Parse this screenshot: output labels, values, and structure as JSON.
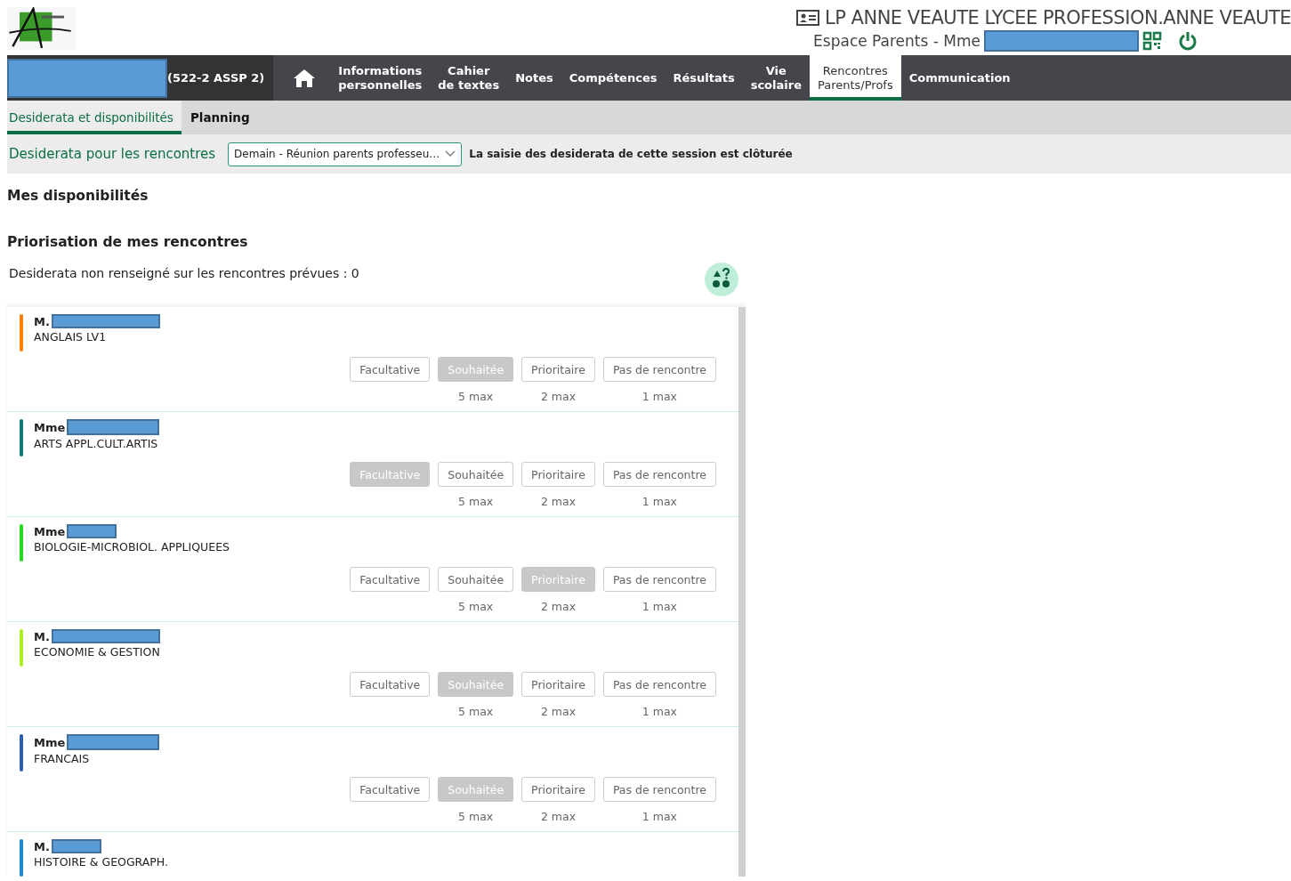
{
  "header": {
    "school": "LP ANNE VEAUTE LYCEE PROFESSION.ANNE VEAUTE",
    "space": "Espace Parents - Mme"
  },
  "nav": {
    "student_class": "(522-2 ASSP 2)",
    "items": [
      {
        "kind": "home",
        "selected": false
      },
      {
        "kind": "text",
        "label": "Informations\npersonnelles",
        "selected": false
      },
      {
        "kind": "text",
        "label": "Cahier\nde textes",
        "selected": false
      },
      {
        "kind": "text",
        "label": "Notes",
        "selected": false
      },
      {
        "kind": "text",
        "label": "Compétences",
        "selected": false
      },
      {
        "kind": "text",
        "label": "Résultats",
        "selected": false
      },
      {
        "kind": "text",
        "label": "Vie\nscolaire",
        "selected": false
      },
      {
        "kind": "text",
        "label": "Rencontres\nParents/Profs",
        "selected": true
      },
      {
        "kind": "text",
        "label": "Communication",
        "selected": false
      }
    ]
  },
  "tabs": [
    {
      "label": "Desiderata et disponibilités",
      "selected": true
    },
    {
      "label": "Planning",
      "selected": false
    }
  ],
  "filter": {
    "label": "Desiderata pour les rencontres",
    "session": "Demain - Réunion parents professeu…",
    "notice": "La saisie des desiderata de cette session est clôturée"
  },
  "sections": [
    {
      "title": "Mes disponibilités"
    },
    {
      "title": "Priorisation de mes rencontres"
    }
  ],
  "summary": "Desiderata non renseigné sur les rencontres prévues : 0",
  "meetings": [
    {
      "civility": "M.",
      "subject": "ANGLAIS LV1",
      "color": "#ff7f00",
      "options": [
        {
          "label": "Facultative",
          "selected": false
        },
        {
          "label": "Souhaitée",
          "limit": "5 max",
          "selected": true
        },
        {
          "label": "Prioritaire",
          "limit": "2 max",
          "selected": false
        },
        {
          "label": "Pas de rencontre",
          "limit": "1 max",
          "selected": false
        }
      ]
    },
    {
      "civility": "Mme",
      "subject": "ARTS APPL.CULT.ARTIS",
      "color": "#117a78",
      "options": [
        {
          "label": "Facultative",
          "selected": true
        },
        {
          "label": "Souhaitée",
          "limit": "5 max",
          "selected": false
        },
        {
          "label": "Prioritaire",
          "limit": "2 max",
          "selected": false
        },
        {
          "label": "Pas de rencontre",
          "limit": "1 max",
          "selected": false
        }
      ]
    },
    {
      "civility": "Mme",
      "subject": "BIOLOGIE-MICROBIOL. APPLIQUEES",
      "color": "#22dd22",
      "options": [
        {
          "label": "Facultative",
          "selected": false
        },
        {
          "label": "Souhaitée",
          "limit": "5 max",
          "selected": false
        },
        {
          "label": "Prioritaire",
          "limit": "2 max",
          "selected": true
        },
        {
          "label": "Pas de rencontre",
          "limit": "1 max",
          "selected": false
        }
      ]
    },
    {
      "civility": "M.",
      "subject": "ECONOMIE & GESTION",
      "color": "#aaee22",
      "options": [
        {
          "label": "Facultative",
          "selected": false
        },
        {
          "label": "Souhaitée",
          "limit": "5 max",
          "selected": true
        },
        {
          "label": "Prioritaire",
          "limit": "2 max",
          "selected": false
        },
        {
          "label": "Pas de rencontre",
          "limit": "1 max",
          "selected": false
        }
      ]
    },
    {
      "civility": "Mme",
      "subject": "FRANCAIS",
      "color": "#2a5faa",
      "options": [
        {
          "label": "Facultative",
          "selected": false
        },
        {
          "label": "Souhaitée",
          "limit": "5 max",
          "selected": true
        },
        {
          "label": "Prioritaire",
          "limit": "2 max",
          "selected": false
        },
        {
          "label": "Pas de rencontre",
          "limit": "1 max",
          "selected": false
        }
      ]
    },
    {
      "civility": "M.",
      "subject": "HISTOIRE & GEOGRAPH.",
      "color": "#1a8ad0"
    }
  ]
}
